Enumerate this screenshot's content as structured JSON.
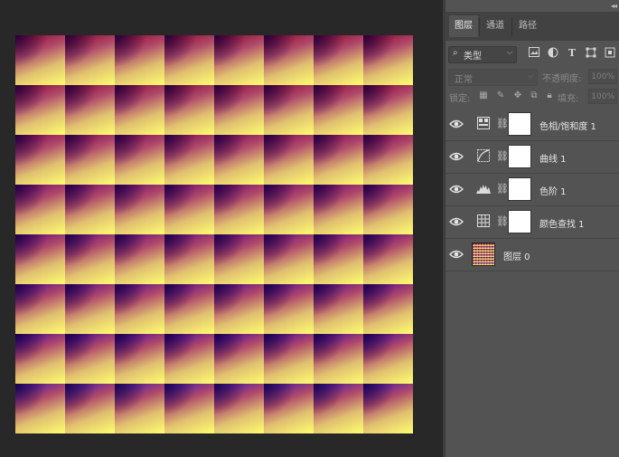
{
  "panel": {
    "tabs": [
      {
        "label": "图层",
        "active": true
      },
      {
        "label": "通道",
        "active": false
      },
      {
        "label": "路径",
        "active": false
      }
    ],
    "filter": {
      "kind_label": "类型",
      "icons": [
        "image-filter-icon",
        "adjustment-filter-icon",
        "text-filter-icon",
        "shape-filter-icon",
        "smart-object-filter-icon"
      ]
    },
    "blend_mode": "正常",
    "opacity_label": "不透明度:",
    "opacity_value": "100%",
    "lock_label": "锁定:",
    "fill_label": "填充:",
    "fill_value": "100%"
  },
  "layers": [
    {
      "name": "色相/饱和度 1",
      "type": "adjustment",
      "icon": "hue-saturation-icon"
    },
    {
      "name": "曲线 1",
      "type": "adjustment",
      "icon": "curves-icon"
    },
    {
      "name": "色阶 1",
      "type": "adjustment",
      "icon": "levels-icon"
    },
    {
      "name": "颜色查找 1",
      "type": "adjustment",
      "icon": "color-lookup-icon"
    },
    {
      "name": "图层 0",
      "type": "pixel",
      "icon": "layer-thumbnail"
    }
  ],
  "canvas": {
    "grid": 8,
    "tile_top_colors": [
      "#8a0028",
      "#850036",
      "#7a0050",
      "#6a0070",
      "#5a0080",
      "#4a0090",
      "#3f00a0",
      "#3a10b0"
    ],
    "tile_bottom_color": "#ffff70",
    "colors": {
      "panel_bg": "#535353",
      "app_bg": "#282828"
    }
  }
}
